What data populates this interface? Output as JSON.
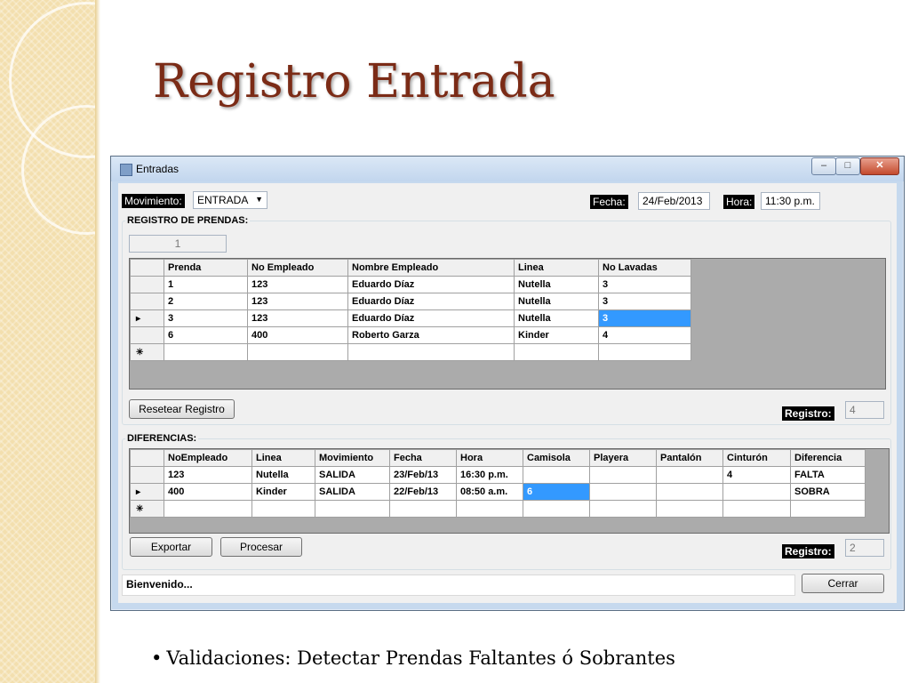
{
  "slide": {
    "title": "Registro Entrada",
    "bullet": "Validaciones: Detectar Prendas Faltantes ó Sobrantes"
  },
  "window": {
    "title": "Entradas",
    "controls": {
      "minimize": "–",
      "maximize": "□",
      "close": "✕"
    }
  },
  "header": {
    "movimiento_label": "Movimiento:",
    "movimiento_value": "ENTRADA",
    "fecha_label": "Fecha:",
    "fecha_value": "24/Feb/2013",
    "hora_label": "Hora:",
    "hora_value": "11:30 p.m."
  },
  "registro_prendas": {
    "title": "REGISTRO DE PRENDAS:",
    "counter": "1",
    "columns": [
      "Prenda",
      "No Empleado",
      "Nombre Empleado",
      "Linea",
      "No Lavadas"
    ],
    "rows": [
      [
        "1",
        "123",
        "Eduardo Díaz",
        "Nutella",
        "3"
      ],
      [
        "2",
        "123",
        "Eduardo Díaz",
        "Nutella",
        "3"
      ],
      [
        "3",
        "123",
        "Eduardo Díaz",
        "Nutella",
        "3"
      ],
      [
        "6",
        "400",
        "Roberto Garza",
        "Kinder",
        "4"
      ]
    ],
    "row_markers": [
      "",
      "",
      "▸",
      "",
      "✳"
    ],
    "reset_button": "Resetear Registro",
    "registro_label": "Registro:",
    "registro_value": "4"
  },
  "diferencias": {
    "title": "DIFERENCIAS:",
    "columns": [
      "NoEmpleado",
      "Linea",
      "Movimiento",
      "Fecha",
      "Hora",
      "Camisola",
      "Playera",
      "Pantalón",
      "Cinturón",
      "Diferencia"
    ],
    "rows": [
      [
        "123",
        "Nutella",
        "SALIDA",
        "23/Feb/13",
        "16:30 p.m.",
        "",
        "",
        "",
        "4",
        "FALTA"
      ],
      [
        "400",
        "Kinder",
        "SALIDA",
        "22/Feb/13",
        "08:50 a.m.",
        "6",
        "",
        "",
        "",
        "SOBRA"
      ]
    ],
    "row_markers": [
      "",
      "▸",
      "✳"
    ],
    "export_button": "Exportar",
    "process_button": "Procesar",
    "registro_label": "Registro:",
    "registro_value": "2"
  },
  "footer": {
    "status": "Bienvenido...",
    "close_button": "Cerrar"
  }
}
